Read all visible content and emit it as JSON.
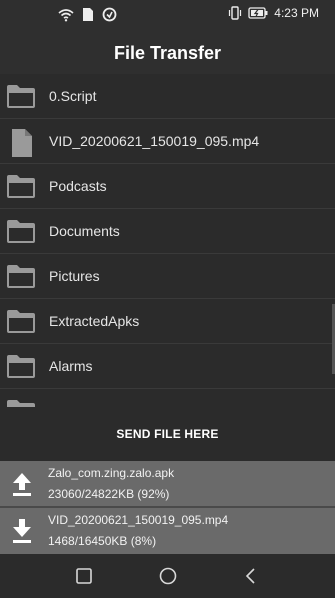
{
  "status_bar": {
    "time": "4:23 PM",
    "left_icons": [
      "wifi-icon",
      "file-icon",
      "sync-icon"
    ],
    "right_icons": [
      "vibrate-icon",
      "battery-charging-icon"
    ]
  },
  "header": {
    "title": "File Transfer"
  },
  "files": [
    {
      "name": "0.Script",
      "type": "folder"
    },
    {
      "name": "VID_20200621_150019_095.mp4",
      "type": "file"
    },
    {
      "name": "Podcasts",
      "type": "folder"
    },
    {
      "name": "Documents",
      "type": "folder"
    },
    {
      "name": "Pictures",
      "type": "folder"
    },
    {
      "name": "ExtractedApks",
      "type": "folder"
    },
    {
      "name": "Alarms",
      "type": "folder"
    }
  ],
  "send_area": {
    "label": "SEND FILE HERE"
  },
  "transfers": [
    {
      "direction": "upload",
      "name": "Zalo_com.zing.zalo.apk",
      "progress": "23060/24822KB (92%)"
    },
    {
      "direction": "download",
      "name": "VID_20200621_150019_095.mp4",
      "progress": "1468/16450KB (8%)"
    }
  ],
  "colors": {
    "background": "#2b2b2b",
    "header": "#2f2f2f",
    "transfer_bg": "#6a6a6a",
    "icon_gray": "#9a9a9a"
  }
}
